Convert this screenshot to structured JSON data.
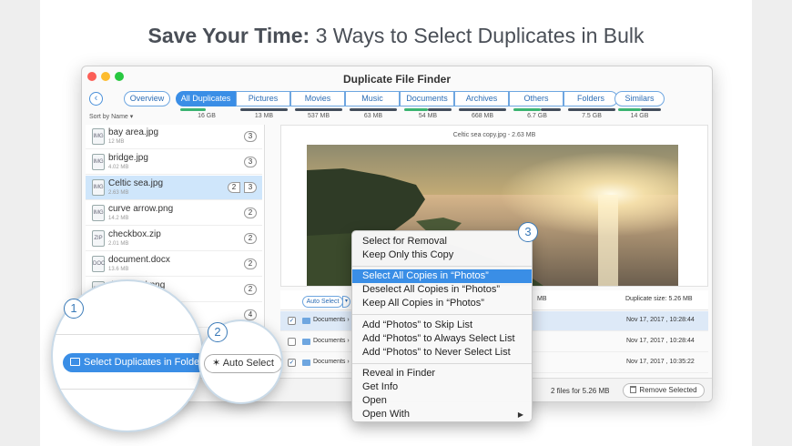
{
  "headline": {
    "bold": "Save Your Time:",
    "rest": " 3 Ways to Select Duplicates in Bulk"
  },
  "window": {
    "title": "Duplicate File Finder"
  },
  "toolbar": {
    "back_label": "‹",
    "overview_label": "Overview",
    "tabs": [
      {
        "label": "All Duplicates",
        "size": "16 GB"
      },
      {
        "label": "Pictures",
        "size": "13 MB"
      },
      {
        "label": "Movies",
        "size": "537 MB"
      },
      {
        "label": "Music",
        "size": "63 MB"
      },
      {
        "label": "Documents",
        "size": "54 MB"
      },
      {
        "label": "Archives",
        "size": "668 MB"
      },
      {
        "label": "Others",
        "size": "6.7 GB"
      },
      {
        "label": "Folders",
        "size": "7.5 GB"
      }
    ],
    "similars_label": "Similars",
    "similars_size": "14 GB",
    "info_label": "i",
    "rss_label": "∿"
  },
  "sortby": "Sort by Name ▾",
  "files": [
    {
      "name": "bay area.jpg",
      "size": "12 MB",
      "count": "3",
      "icon": "IMG"
    },
    {
      "name": "bridge.jpg",
      "size": "4.02 MB",
      "count": "3",
      "icon": "IMG"
    },
    {
      "name": "Celtic sea.jpg",
      "size": "2.63 MB",
      "count": "3",
      "count_left": "2",
      "icon": "IMG"
    },
    {
      "name": "curve arrow.png",
      "size": "14.2 MB",
      "count": "2",
      "icon": "IMG"
    },
    {
      "name": "checkbox.zip",
      "size": "2.01 MB",
      "count": "2",
      "icon": "ZIP"
    },
    {
      "name": "document.docx",
      "size": "13.6 MB",
      "count": "2",
      "icon": "DOC"
    },
    {
      "name": "download.png",
      "size": "",
      "count": "2",
      "icon": "IMG"
    },
    {
      "name": "",
      "size": "",
      "count": "4",
      "icon": "IMG"
    }
  ],
  "preview": {
    "title": "Celtic sea copy.jpg - 2.63 MB"
  },
  "details": {
    "auto_select": "Auto Select",
    "mb_text": "MB",
    "duplicate_size": "Duplicate size: 5.26 MB",
    "rows": [
      {
        "path": "Documents ›",
        "date": "Nov 17, 2017 , 10:28:44",
        "checked": "✓"
      },
      {
        "path": "Documents ›",
        "date": "Nov 17, 2017 , 10:28:44",
        "checked": ""
      },
      {
        "path": "Documents ›",
        "date": "Nov 17, 2017 , 10:35:22",
        "checked": "✓"
      }
    ]
  },
  "status": {
    "files_for": "2 files for 5.26 MB",
    "remove_label": "Remove Selected"
  },
  "magnifiers": {
    "select_in_folder": "Select Duplicates in Folder",
    "auto_select": "Auto Select"
  },
  "badges": [
    "1",
    "2",
    "3"
  ],
  "context_menu": {
    "groups": [
      [
        "Select for Removal",
        "Keep Only this Copy"
      ],
      [
        "Select All Copies in “Photos”",
        "Deselect All Copies in “Photos”",
        "Keep All Copies in “Photos”"
      ],
      [
        "Add “Photos” to Skip List",
        "Add “Photos” to Always Select List",
        "Add “Photos” to Never Select List"
      ],
      [
        "Reveal in Finder",
        "Get Info",
        "Open",
        "Open With"
      ]
    ],
    "submenu_arrow": "▶"
  },
  "colors": {
    "accent": "#3a8ee6",
    "close": "#fc5f57",
    "minimize": "#fdbc2e",
    "zoom": "#28c840",
    "highlight": "#3a8ee6"
  }
}
